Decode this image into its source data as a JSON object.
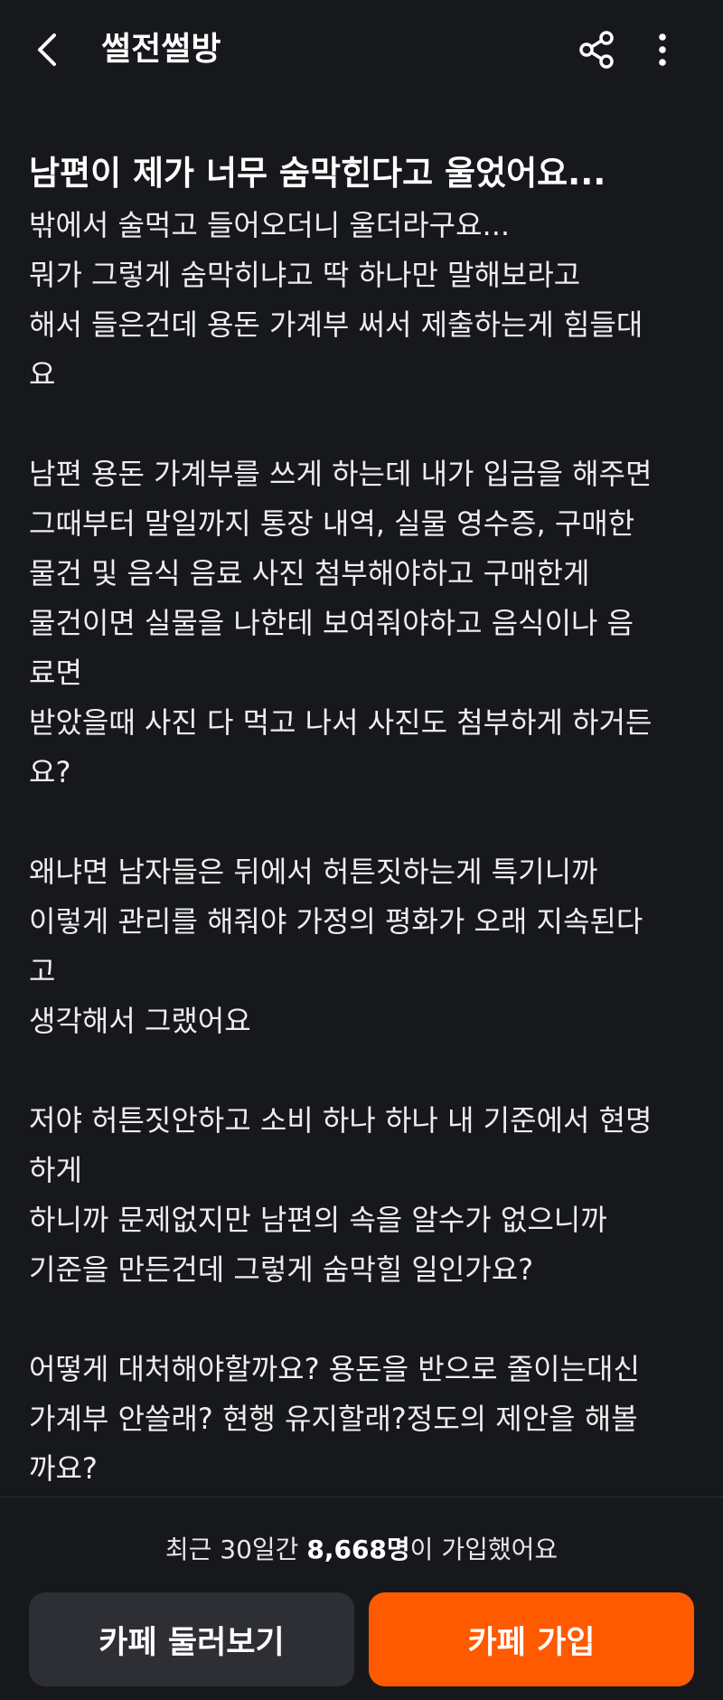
{
  "header": {
    "title": "썰전썰방",
    "back_icon": "chevron-left-icon",
    "share_icon": "share-icon",
    "more_icon": "more-vertical-icon"
  },
  "post": {
    "title": "남편이 제가 너무 숨막힌다고 울었어요...",
    "lines": [
      "밖에서 술먹고 들어오더니 울더라구요...",
      "뭐가 그렇게 숨막히냐고 딱 하나만 말해보라고",
      "해서 들은건데 용돈 가계부 써서 제출하는게 힘들대",
      "요",
      "",
      "남편 용돈 가계부를 쓰게 하는데 내가 입금을 해주면",
      "그때부터 말일까지 통장 내역, 실물 영수증, 구매한",
      "물건 및 음식 음료 사진 첨부해야하고 구매한게",
      "물건이면 실물을 나한테 보여줘야하고 음식이나 음",
      "료면",
      "받았을때 사진 다 먹고 나서 사진도 첨부하게 하거든",
      "요?",
      "",
      "왜냐면 남자들은 뒤에서 허튼짓하는게 특기니까",
      "이렇게 관리를 해줘야 가정의 평화가 오래 지속된다",
      "고",
      "생각해서 그랬어요",
      "",
      "저야 허튼짓안하고 소비 하나 하나 내 기준에서 현명",
      "하게",
      "하니까 문제없지만 남편의 속을 알수가 없으니까",
      "기준을 만든건데 그렇게 숨막힐 일인가요?",
      "",
      "어떻게 대처해야할까요? 용돈을 반으로 줄이는대신",
      "가계부 안쓸래? 현행 유지할래?정도의 제안을 해볼",
      "까요?"
    ]
  },
  "footer": {
    "join_prefix": "최근 30일간 ",
    "join_count": "8,668명",
    "join_suffix": "이 가입했어요",
    "browse_label": "카페 둘러보기",
    "join_label": "카페 가입"
  },
  "colors": {
    "background": "#17181c",
    "accent": "#ff5a00",
    "secondary_button": "#2d2f35"
  }
}
